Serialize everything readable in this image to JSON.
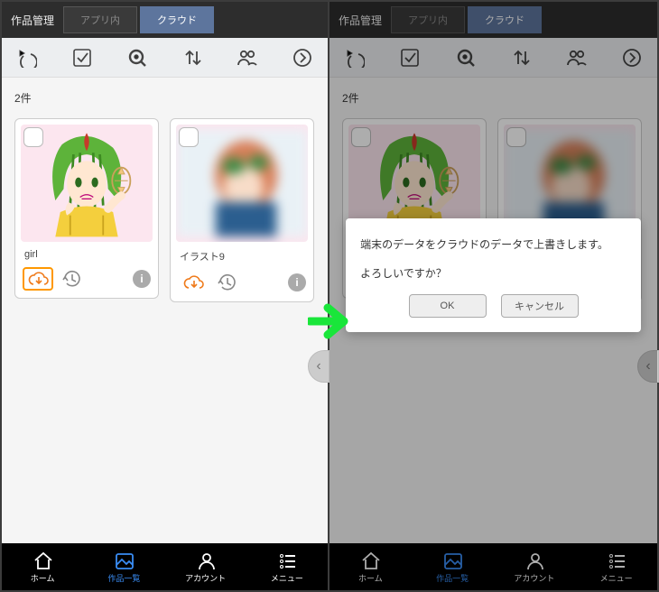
{
  "header": {
    "title": "作品管理",
    "tabs": {
      "app_in": "アプリ内",
      "cloud": "クラウド"
    }
  },
  "count_label": "2件",
  "cards": [
    {
      "title": "girl"
    },
    {
      "title": "イラスト9"
    }
  ],
  "nav": {
    "home": "ホーム",
    "works": "作品一覧",
    "account": "アカウント",
    "menu": "メニュー"
  },
  "modal": {
    "line1": "端末のデータをクラウドのデータで上書きします。",
    "line2": "よろしいですか？",
    "ok": "OK",
    "cancel": "キャンセル"
  }
}
